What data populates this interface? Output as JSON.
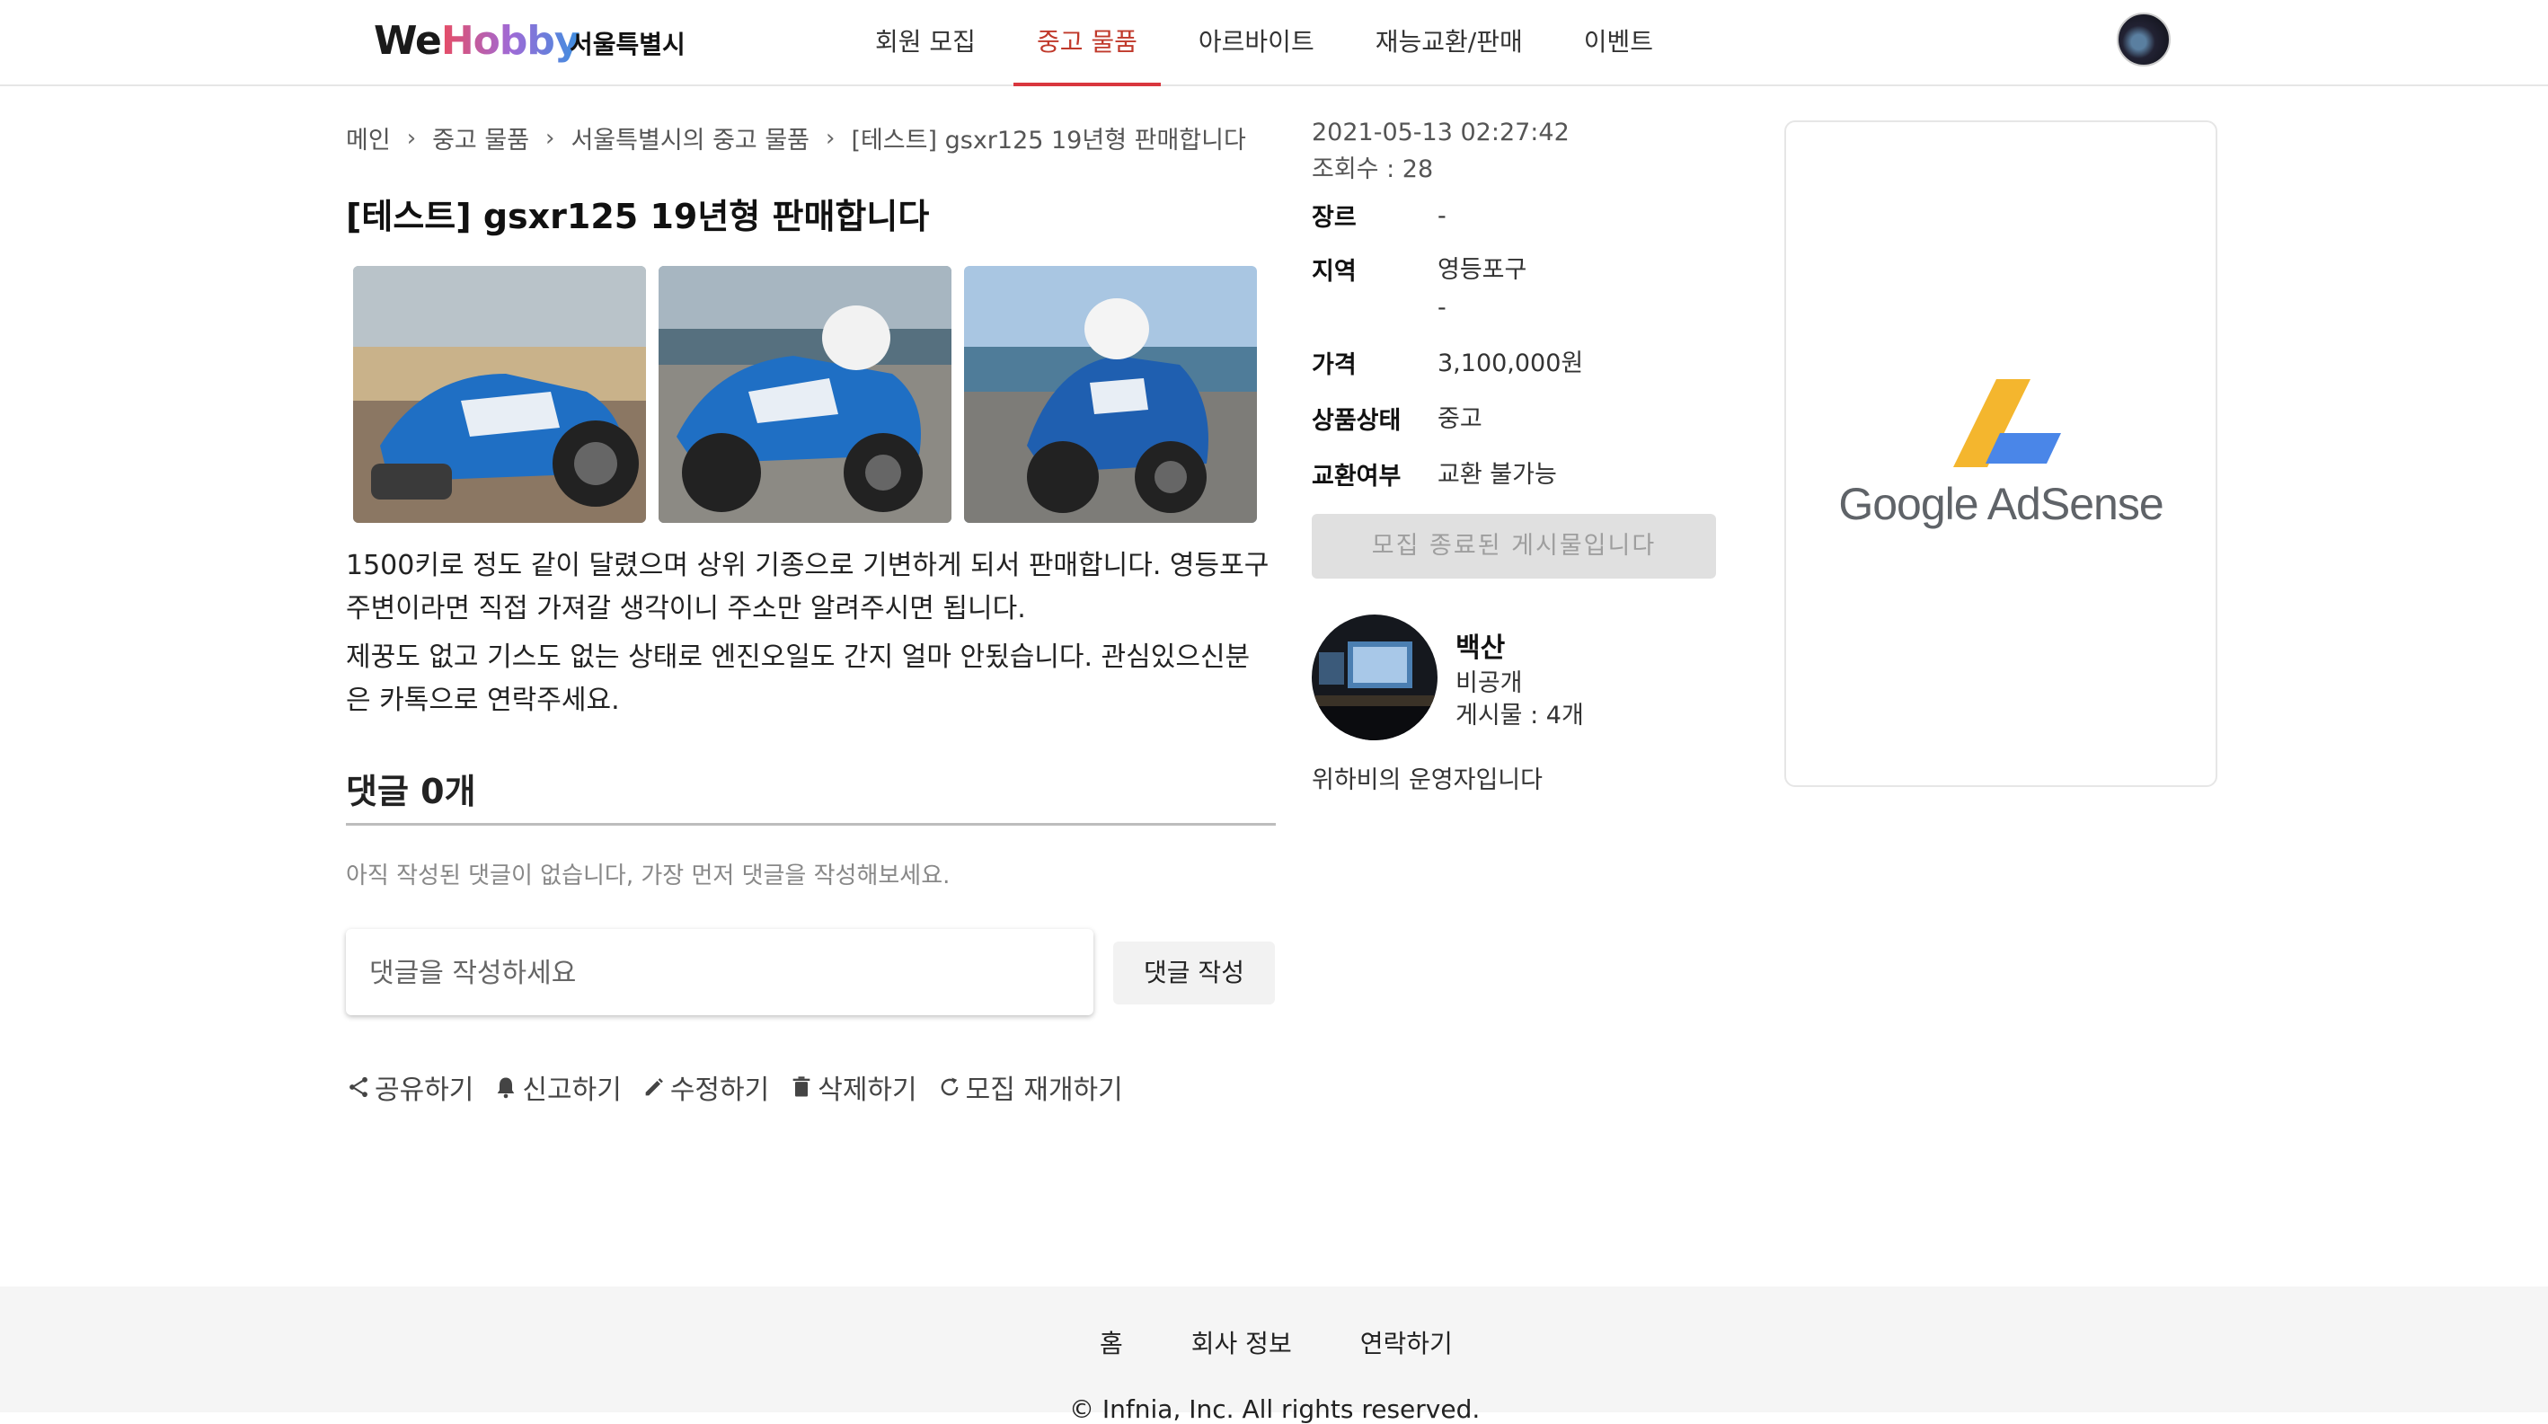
{
  "header": {
    "logo_we": "We",
    "logo_hobby": "Hobby",
    "region": "서울특별시",
    "nav": [
      "회원 모집",
      "중고 물품",
      "아르바이트",
      "재능교환/판매",
      "이벤트"
    ],
    "active_nav": "중고 물품"
  },
  "breadcrumb": [
    "메인",
    "중고 물품",
    "서울특별시의 중고 물품",
    "[테스트] gsxr125 19년형 판매합니다"
  ],
  "post": {
    "title": "[테스트] gsxr125 19년형 판매합니다",
    "description": [
      "1500키로 정도 같이 달렸으며 상위 기종으로 기변하게 되서 판매합니다. 영등포구 주변이라면 직접 가져갈 생각이니 주소만 알려주시면 됩니다.",
      "제꿍도 없고 기스도 없는 상태로 엔진오일도 간지 얼마 안됬습니다. 관심있으신분은 카톡으로 연락주세요."
    ]
  },
  "comments": {
    "heading": "댓글 0개",
    "empty": "아직 작성된 댓글이 없습니다, 가장 먼저 댓글을 작성해보세요.",
    "placeholder": "댓글을 작성하세요",
    "submit": "댓글 작성"
  },
  "actions": [
    "공유하기",
    "신고하기",
    "수정하기",
    "삭제하기",
    "모집 재개하기"
  ],
  "meta": {
    "date": "2021-05-13 02:27:42",
    "views": "조회수 : 28"
  },
  "info": {
    "genre_label": "장르",
    "genre": "-",
    "area_label": "지역",
    "area": "영등포구",
    "area_detail": "-",
    "price_label": "가격",
    "price": "3,100,000원",
    "condition_label": "상품상태",
    "condition": "중고",
    "exchange_label": "교환여부",
    "exchange": "교환 불가능"
  },
  "closed_label": "모집 종료된 게시물입니다",
  "author": {
    "name": "백산",
    "visibility": "비공개",
    "posts": "게시물 : 4개",
    "bio": "위하비의 운영자입니다"
  },
  "ad": {
    "text": "Google AdSense"
  },
  "footer": {
    "links": [
      "홈",
      "회사 정보",
      "연락하기"
    ],
    "copyright": "© Infnia, Inc. All rights reserved."
  },
  "colors": {
    "accent": "#d9363e",
    "bike_blue": "#1f6fc4"
  }
}
